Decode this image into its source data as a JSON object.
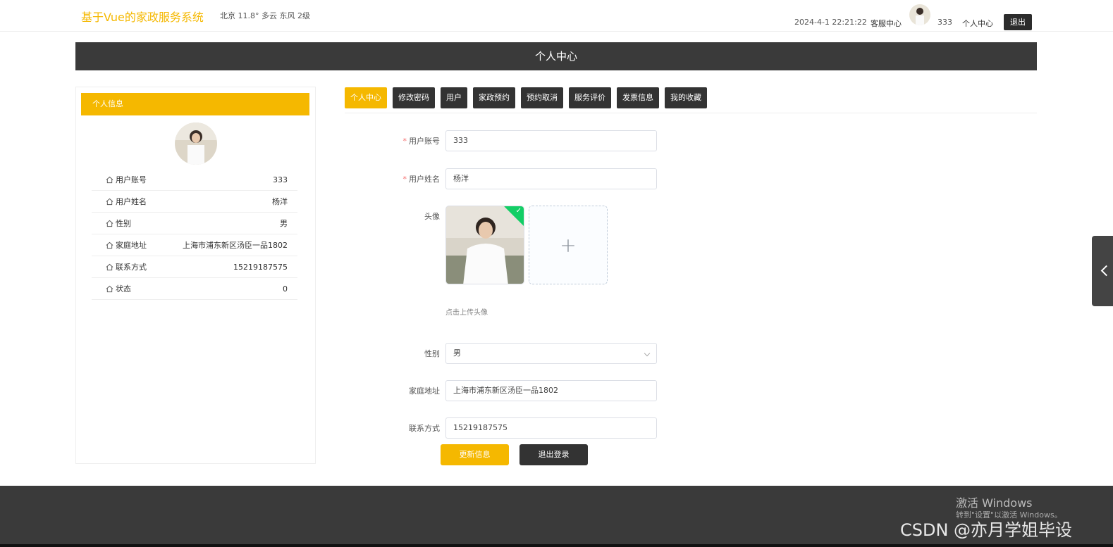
{
  "header": {
    "site_title": "基于Vue的家政服务系统",
    "weather": "北京  11.8°  多云  东风  2级",
    "datetime": "2024-4-1 22:21:22",
    "service_link": "客服中心",
    "username": "333",
    "center_link": "个人中心",
    "logout": "退出"
  },
  "banner": {
    "title": "个人中心"
  },
  "info_card": {
    "title": "个人信息",
    "rows": [
      {
        "label": "用户账号",
        "value": "333"
      },
      {
        "label": "用户姓名",
        "value": "杨洋"
      },
      {
        "label": "性别",
        "value": "男"
      },
      {
        "label": "家庭地址",
        "value": "上海市浦东新区汤臣一品1802"
      },
      {
        "label": "联系方式",
        "value": "15219187575"
      },
      {
        "label": "状态",
        "value": "0"
      }
    ]
  },
  "tabs": [
    {
      "label": "个人中心",
      "active": true
    },
    {
      "label": "修改密码"
    },
    {
      "label": "用户"
    },
    {
      "label": "家政预约"
    },
    {
      "label": "预约取消"
    },
    {
      "label": "服务评价"
    },
    {
      "label": "发票信息"
    },
    {
      "label": "我的收藏"
    }
  ],
  "form": {
    "account_label": "用户账号",
    "account_value": "333",
    "name_label": "用户姓名",
    "name_value": "杨洋",
    "avatar_label": "头像",
    "upload_tip": "点击上传头像",
    "gender_label": "性别",
    "gender_value": "男",
    "address_label": "家庭地址",
    "address_value": "上海市浦东新区汤臣一品1802",
    "phone_label": "联系方式",
    "phone_value": "15219187575",
    "update_button": "更新信息",
    "logout_button": "退出登录"
  },
  "footer": {
    "windows_title": "激活 Windows",
    "windows_sub": "转到\"设置\"以激活 Windows。",
    "watermark": "CSDN @亦月学姐毕设"
  },
  "colors": {
    "accent": "#f5b800",
    "dark": "#333333"
  }
}
